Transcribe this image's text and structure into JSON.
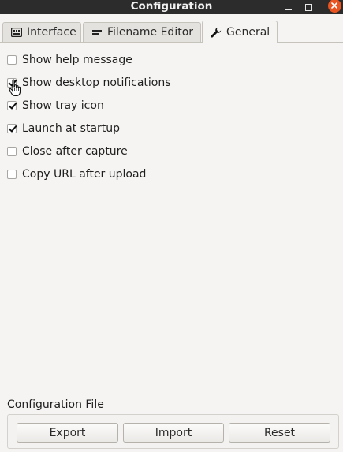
{
  "window": {
    "title": "Configuration"
  },
  "tabs": [
    {
      "label": "Interface",
      "icon": "keyboard-icon",
      "active": false
    },
    {
      "label": "Filename Editor",
      "icon": "text-lines-icon",
      "active": false
    },
    {
      "label": "General",
      "icon": "wrench-icon",
      "active": true
    }
  ],
  "options": [
    {
      "label": "Show help message",
      "checked": false
    },
    {
      "label": "Show desktop notifications",
      "checked": true
    },
    {
      "label": "Show tray icon",
      "checked": true
    },
    {
      "label": "Launch at startup",
      "checked": true
    },
    {
      "label": "Close after capture",
      "checked": false
    },
    {
      "label": "Copy URL after upload",
      "checked": false
    }
  ],
  "config_file": {
    "title": "Configuration File",
    "export_label": "Export",
    "import_label": "Import",
    "reset_label": "Reset"
  },
  "colors": {
    "titlebar": "#2c2c2c",
    "close_button": "#e95420",
    "background": "#f5f4f2"
  }
}
